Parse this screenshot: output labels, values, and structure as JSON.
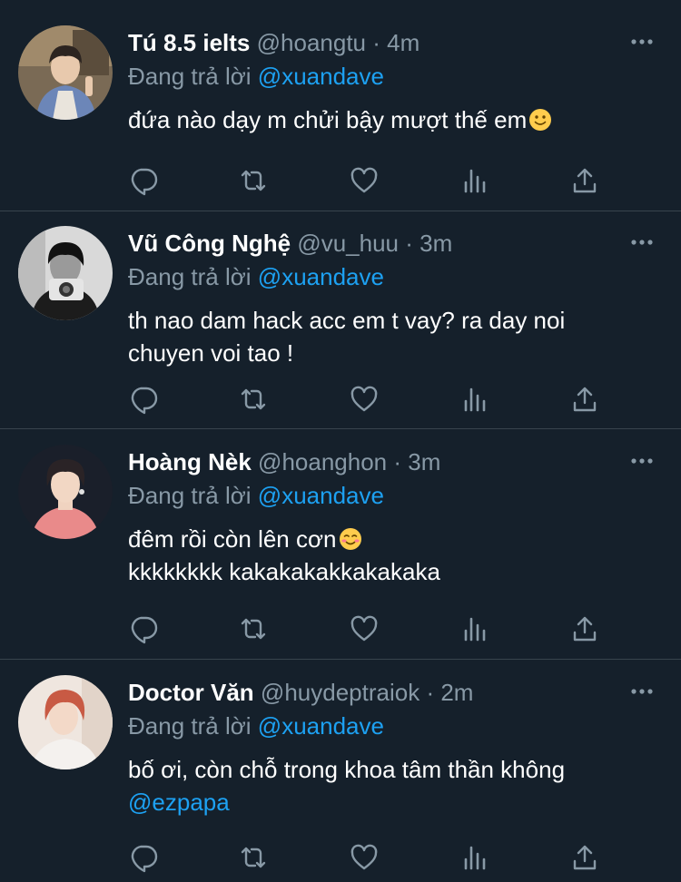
{
  "colors": {
    "background": "#15202b",
    "divider": "#38444d",
    "secondary_text": "#8899a6",
    "accent": "#1da1f2",
    "primary_text": "#ffffff"
  },
  "action_icons": [
    "reply-icon",
    "retweet-icon",
    "like-icon",
    "analytics-icon",
    "share-icon"
  ],
  "tweets": [
    {
      "name": "Tú 8.5 ielts",
      "handle": "@hoangtu",
      "separator": "·",
      "time": "4m",
      "reply_prefix": "Đang trả lời",
      "reply_to": "@xuandave",
      "text_lines": [
        "đứa nào dạy m chửi bậy mượt thế em"
      ],
      "emoji": "slightly-smiling-face-icon"
    },
    {
      "name": "Vũ Công Nghệ",
      "handle": "@vu_huu",
      "separator": "·",
      "time": "3m",
      "reply_prefix": "Đang trả lời",
      "reply_to": "@xuandave",
      "text_lines": [
        "th nao dam hack acc em t vay? ra day noi",
        "chuyen voi tao !"
      ]
    },
    {
      "name": "Hoàng Nèk",
      "handle": "@hoanghon",
      "separator": "·",
      "time": "3m",
      "reply_prefix": "Đang trả lời",
      "reply_to": "@xuandave",
      "text_lines": [
        "đêm rồi còn lên cơn",
        "kkkkkkkk kakakakakkakakaka"
      ],
      "emoji": "smiling-face-icon"
    },
    {
      "name": "Doctor Văn",
      "handle": "@huydeptraiok",
      "separator": "·",
      "time": "2m",
      "reply_prefix": "Đang trả lời",
      "reply_to": "@xuandave",
      "text_lines": [
        "bố ơi, còn chỗ trong khoa tâm thần không"
      ],
      "mention_line": "@ezpapa"
    }
  ]
}
